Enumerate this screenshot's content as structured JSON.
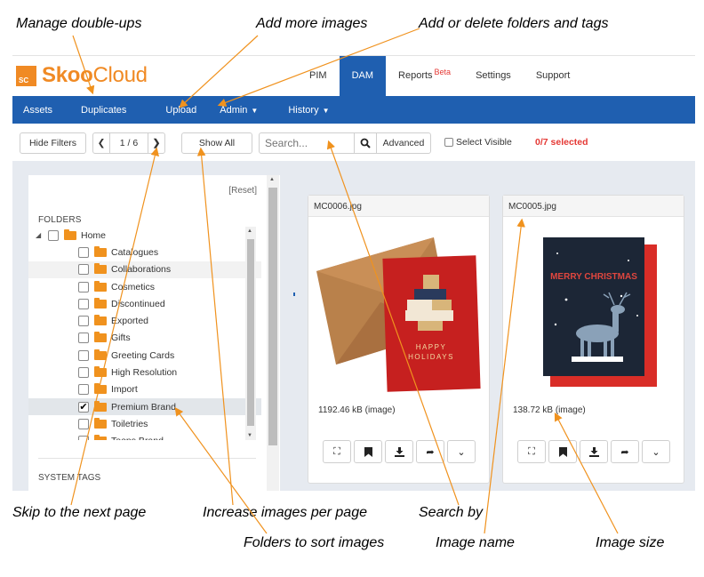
{
  "annotations": {
    "manage_doubleups": "Manage double-ups",
    "add_images": "Add more images",
    "add_delete": "Add or delete folders and tags",
    "skip_page": "Skip to the next page",
    "increase_images": "Increase images per page",
    "search_by": "Search by",
    "folders_sort": "Folders to sort images",
    "image_name": "Image name",
    "image_size": "Image size"
  },
  "logo": {
    "badge": "SC",
    "name_bold": "Skoo",
    "name_rest": "Cloud"
  },
  "topnav": {
    "items": [
      {
        "label": "PIM"
      },
      {
        "label": "DAM",
        "active": true
      },
      {
        "label": "Reports",
        "badge": "Beta"
      },
      {
        "label": "Settings"
      },
      {
        "label": "Support"
      }
    ]
  },
  "bluebar": {
    "assets": "Assets",
    "duplicates": "Duplicates",
    "upload": "Upload",
    "admin": "Admin",
    "history": "History"
  },
  "toolbar": {
    "hide_filters": "Hide Filters",
    "page": "1 / 6",
    "show_all": "Show All",
    "search_placeholder": "Search...",
    "advanced": "Advanced",
    "select_visible": "Select Visible",
    "selected_count": "0/7 selected"
  },
  "filters": {
    "reset": "[Reset]",
    "folders_label": "FOLDERS",
    "home": "Home",
    "folders": [
      {
        "name": "Catalogues",
        "checked": false
      },
      {
        "name": "Collaborations",
        "checked": false
      },
      {
        "name": "Cosmetics",
        "checked": false
      },
      {
        "name": "Discontinued",
        "checked": false
      },
      {
        "name": "Exported",
        "checked": false
      },
      {
        "name": "Gifts",
        "checked": false
      },
      {
        "name": "Greeting Cards",
        "checked": false
      },
      {
        "name": "High Resolution",
        "checked": false
      },
      {
        "name": "Import",
        "checked": false
      },
      {
        "name": "Premium Brand",
        "checked": true
      },
      {
        "name": "Toiletries",
        "checked": false
      },
      {
        "name": "Teens Brand",
        "checked": false
      }
    ],
    "system_tags_label": "SYSTEM TAGS"
  },
  "cards": [
    {
      "filename": "MC0006.jpg",
      "size": "1192.46 kB (image)",
      "card_text": [
        "HAPPY",
        "HOLIDAYS"
      ]
    },
    {
      "filename": "MC0005.jpg",
      "size": "138.72 kB (image)",
      "card_text": [
        "MERRY CHRISTMAS"
      ]
    }
  ],
  "colors": {
    "brand_orange": "#f08a24",
    "nav_blue": "#1f5fb0",
    "selected_red": "#e53935"
  },
  "icons": {
    "fullscreen": "fullscreen-icon",
    "bookmark": "bookmark-icon",
    "download": "download-icon",
    "share": "share-icon",
    "more": "chevron-down-icon",
    "search": "search-icon"
  }
}
